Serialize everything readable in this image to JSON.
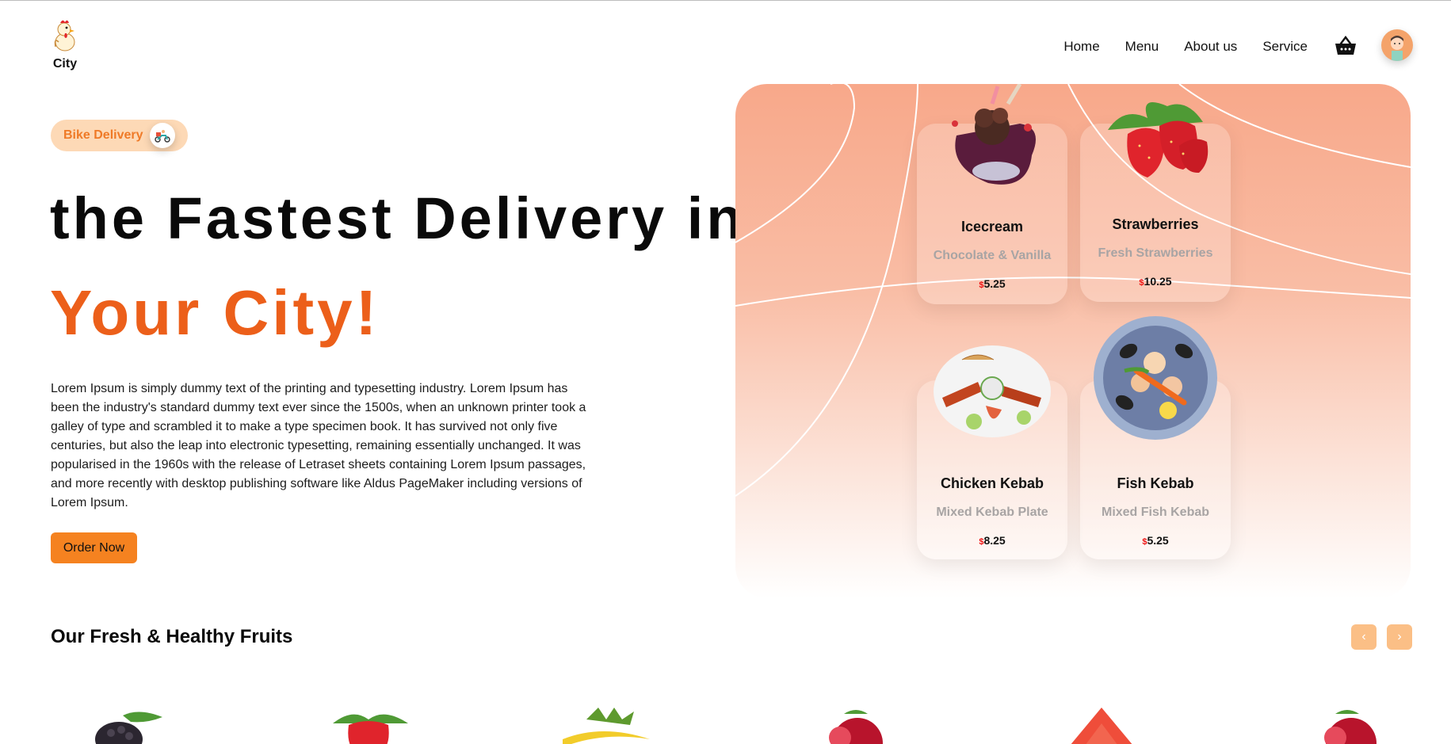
{
  "brand": {
    "name": "City"
  },
  "nav": {
    "items": [
      "Home",
      "Menu",
      "About us",
      "Service"
    ]
  },
  "hero": {
    "badge": "Bike Delivery",
    "title_line1": "the Fastest Delivery in",
    "title_line2": "Your City!",
    "description": "Lorem Ipsum is simply dummy text of the printing and typesetting industry. Lorem Ipsum has been the industry's standard dummy text ever since the 1500s, when an unknown printer took a galley of type and scrambled it to make a type specimen book. It has survived not only five centuries, but also the leap into electronic typesetting, remaining essentially unchanged. It was popularised in the 1960s with the release of Letraset sheets containing Lorem Ipsum passages, and more recently with desktop publishing software like Aldus PageMaker including versions of Lorem Ipsum.",
    "cta": "Order Now"
  },
  "cards": [
    {
      "name": "Icecream",
      "sub": "Chocolate & Vanilla",
      "currency": "$",
      "price": "5.25"
    },
    {
      "name": "Strawberries",
      "sub": "Fresh Strawberries",
      "currency": "$",
      "price": "10.25"
    },
    {
      "name": "Chicken Kebab",
      "sub": "Mixed Kebab Plate",
      "currency": "$",
      "price": "8.25"
    },
    {
      "name": "Fish Kebab",
      "sub": "Mixed Fish Kebab",
      "currency": "$",
      "price": "5.25"
    }
  ],
  "fruits_section": {
    "title": "Our Fresh & Healthy Fruits",
    "prev": "‹",
    "next": "›"
  },
  "colors": {
    "accent": "#f58220",
    "title_orange": "#ec5f1a",
    "badge_bg": "#fdd9b6",
    "panel_top": "#f8a88a"
  }
}
